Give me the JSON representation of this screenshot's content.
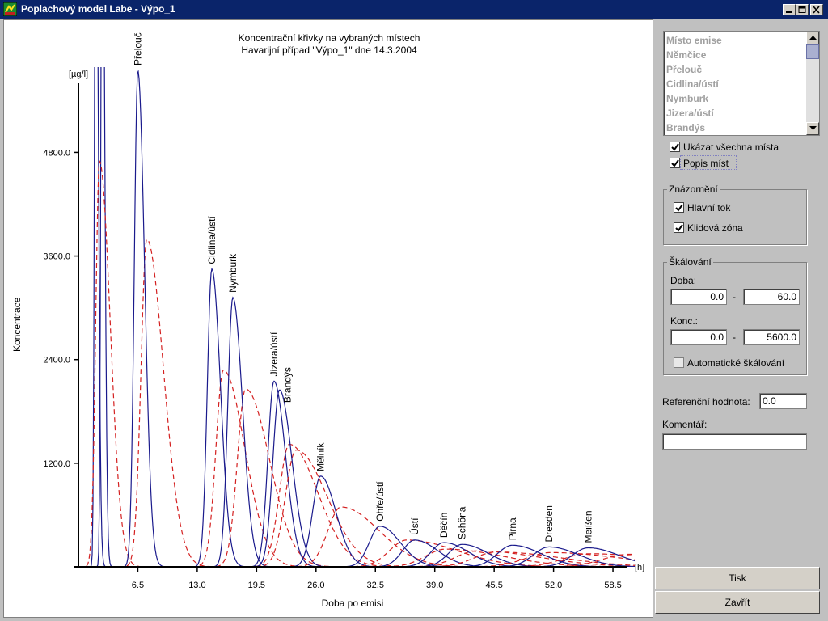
{
  "window": {
    "title": "Poplachový model Labe - Výpo_1"
  },
  "chart_data": {
    "type": "line",
    "title": "Koncentrační křivky na vybraných místech",
    "subtitle": "Havarijní případ \"Výpo_1\" dne 14.3.2004",
    "xlabel": "Doba po emisi",
    "ylabel": "Koncentrace",
    "xunit": "[h]",
    "yunit": "[µg/l]",
    "xlim": [
      0,
      60
    ],
    "ylim": [
      0,
      5600
    ],
    "xticks": [
      "6.5",
      "13.0",
      "19.5",
      "26.0",
      "32.5",
      "39.0",
      "45.5",
      "52.0",
      "58.5"
    ],
    "yticks": [
      "1200.0",
      "2400.0",
      "3600.0",
      "4800.0"
    ],
    "series": [
      {
        "name": "Hlavní tok",
        "color": "#1a1a8c",
        "style": "solid"
      },
      {
        "name": "Klidová zóna",
        "color": "#d42020",
        "style": "dashed"
      }
    ],
    "peaks": [
      {
        "label": "Přelouč",
        "x": 6.5,
        "y": 5750,
        "w": 0.7
      },
      {
        "label": "Cidlina/ústí",
        "x": 14.6,
        "y": 3450,
        "w": 0.9
      },
      {
        "label": "Nymburk",
        "x": 16.9,
        "y": 3120,
        "w": 1.0
      },
      {
        "label": "Jizera/ústí",
        "x": 21.4,
        "y": 2150,
        "w": 1.2
      },
      {
        "label": "Brandýs",
        "x": 22.0,
        "y": 2050,
        "w": 1.3
      },
      {
        "label": "Mělník",
        "x": 26.5,
        "y": 1050,
        "w": 1.6
      },
      {
        "label": "Ohře/ústí",
        "x": 33.0,
        "y": 470,
        "w": 2.1
      },
      {
        "label": "Ústí",
        "x": 36.8,
        "y": 310,
        "w": 2.4
      },
      {
        "label": "Děčín",
        "x": 40.0,
        "y": 280,
        "w": 2.6
      },
      {
        "label": "Schöna",
        "x": 42.0,
        "y": 260,
        "w": 2.7
      },
      {
        "label": "Pirna",
        "x": 47.5,
        "y": 250,
        "w": 3.0
      },
      {
        "label": "Dresden",
        "x": 51.5,
        "y": 230,
        "w": 3.1
      },
      {
        "label": "Meißen",
        "x": 55.8,
        "y": 220,
        "w": 3.2
      }
    ]
  },
  "side": {
    "places": [
      "Místo emise",
      "Němčice",
      "Přelouč",
      "Cidlina/ústí",
      "Nymburk",
      "Jizera/ústí",
      "Brandýs"
    ],
    "show_all": "Ukázat všechna místa",
    "labels": "Popis míst",
    "display_group": "Znázornění",
    "main_flow": "Hlavní tok",
    "calm_zone": "Klidová zóna",
    "scaling_group": "Škálování",
    "time_label": "Doba:",
    "time_from": "0.0",
    "time_to": "60.0",
    "conc_label": "Konc.:",
    "conc_from": "0.0",
    "conc_to": "5600.0",
    "dash": "-",
    "auto_scale": "Automatické škálování",
    "reference_label": "Referenční hodnota:",
    "reference_value": "0.0",
    "comment_label": "Komentář:",
    "comment_value": "",
    "print_button": "Tisk",
    "close_button": "Zavřít"
  }
}
